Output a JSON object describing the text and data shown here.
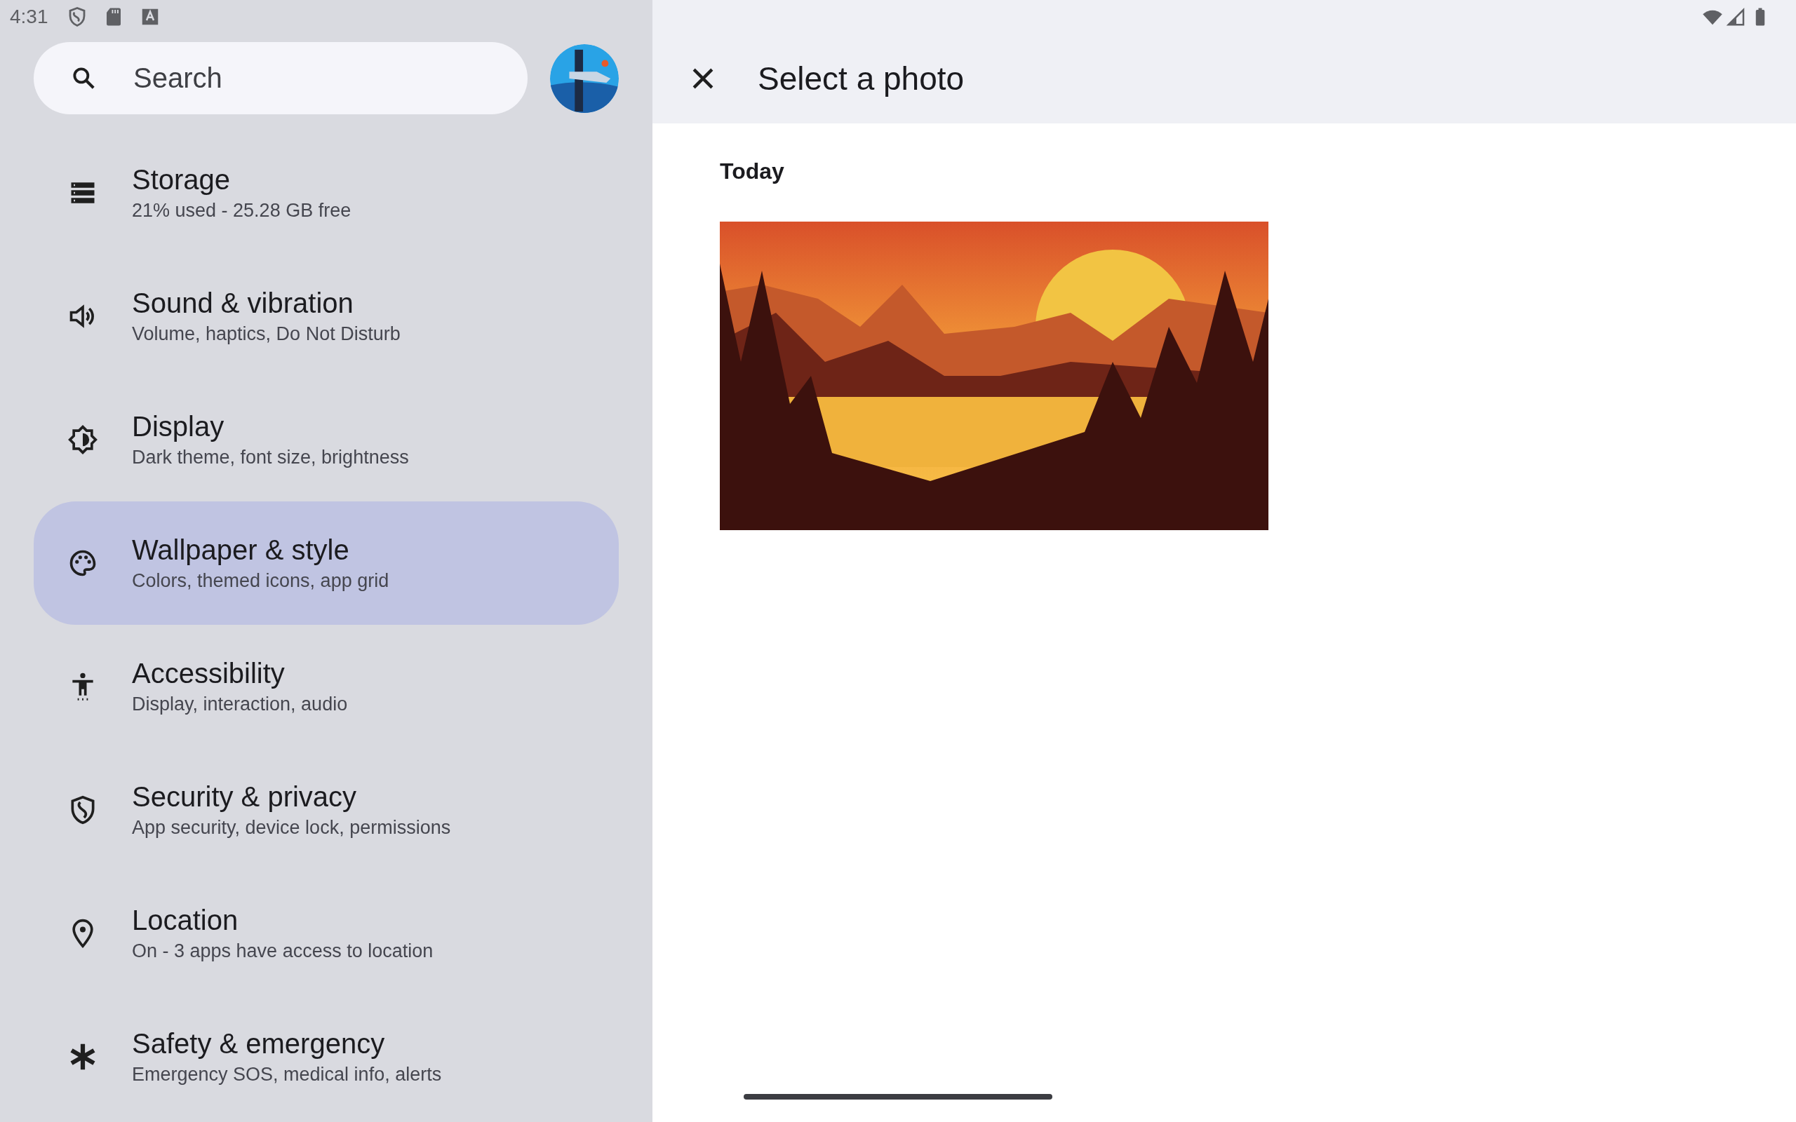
{
  "status_bar": {
    "time": "4:31"
  },
  "search": {
    "placeholder": "Search"
  },
  "settings": [
    {
      "title": "Storage",
      "subtitle": "21% used - 25.28 GB free",
      "selected": false
    },
    {
      "title": "Sound & vibration",
      "subtitle": "Volume, haptics, Do Not Disturb",
      "selected": false
    },
    {
      "title": "Display",
      "subtitle": "Dark theme, font size, brightness",
      "selected": false
    },
    {
      "title": "Wallpaper & style",
      "subtitle": "Colors, themed icons, app grid",
      "selected": true
    },
    {
      "title": "Accessibility",
      "subtitle": "Display, interaction, audio",
      "selected": false
    },
    {
      "title": "Security & privacy",
      "subtitle": "App security, device lock, permissions",
      "selected": false
    },
    {
      "title": "Location",
      "subtitle": "On - 3 apps have access to location",
      "selected": false
    },
    {
      "title": "Safety & emergency",
      "subtitle": "Emergency SOS, medical info, alerts",
      "selected": false
    }
  ],
  "photo_picker": {
    "title": "Select a photo",
    "section": "Today"
  }
}
